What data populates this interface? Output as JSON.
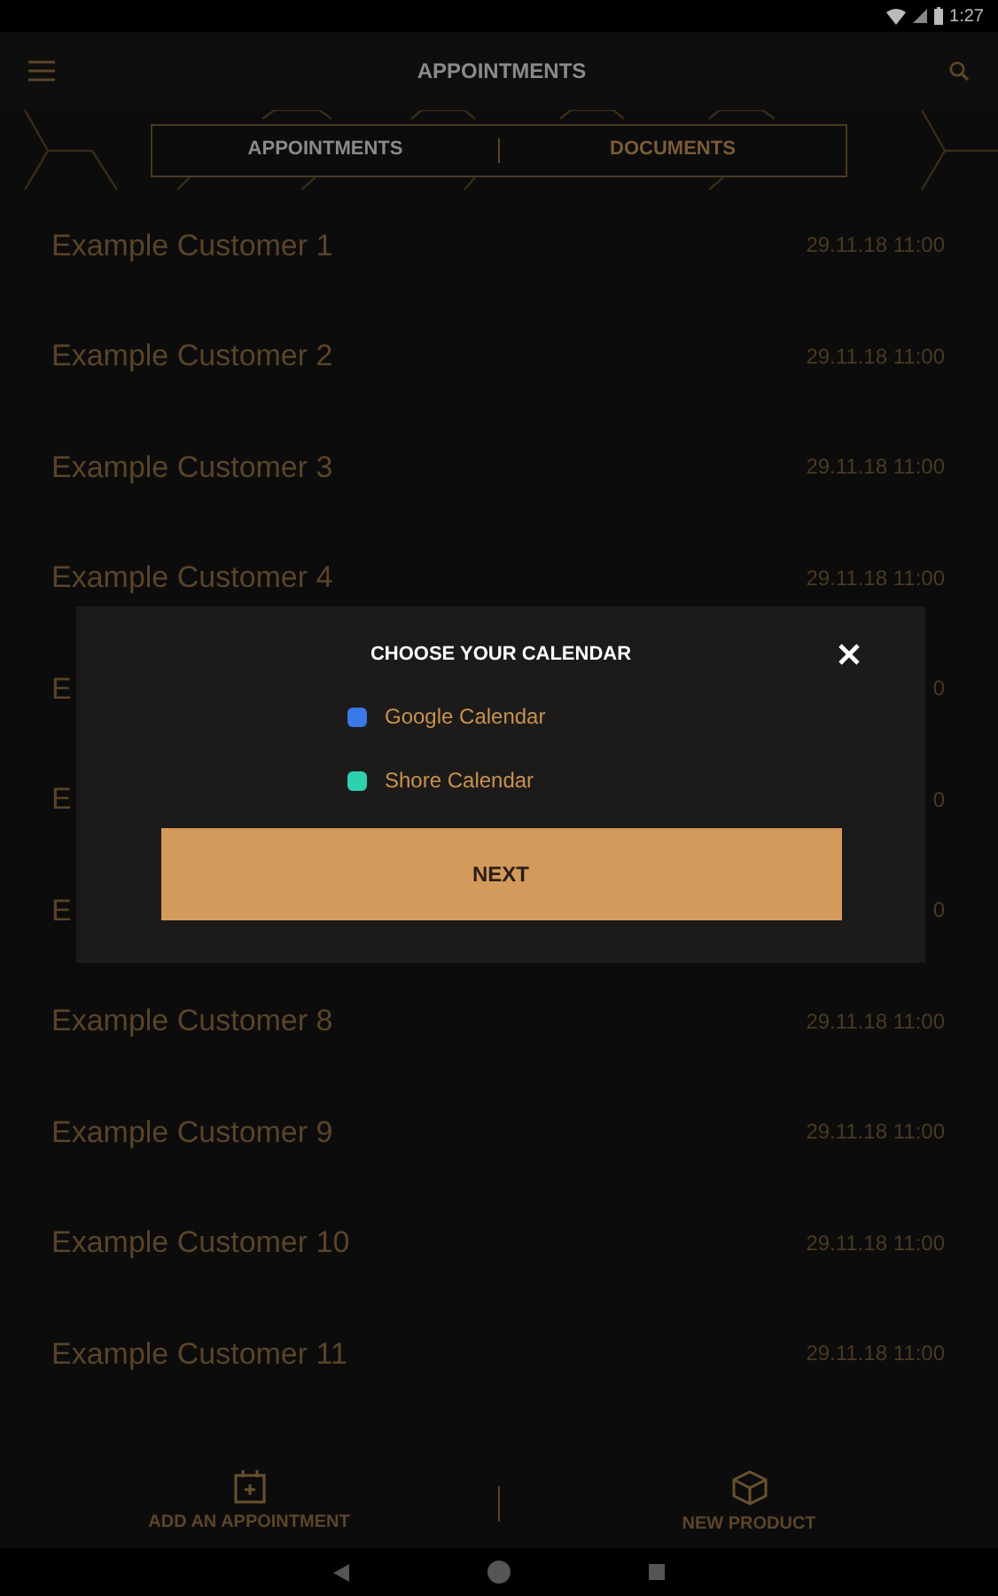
{
  "status_bar": {
    "time": "1:27"
  },
  "app_bar": {
    "title": "APPOINTMENTS"
  },
  "tabs": [
    {
      "label": "APPOINTMENTS",
      "selected": true
    },
    {
      "label": "DOCUMENTS",
      "selected": false
    }
  ],
  "appointments": [
    {
      "customer": "Example Customer 1",
      "time": "29.11.18 11:00"
    },
    {
      "customer": "Example Customer 2",
      "time": "29.11.18 11:00"
    },
    {
      "customer": "Example Customer 3",
      "time": "29.11.18 11:00"
    },
    {
      "customer": "Example Customer 4",
      "time": "29.11.18 11:00"
    },
    {
      "customer": "E",
      "time": "0"
    },
    {
      "customer": "E",
      "time": "0"
    },
    {
      "customer": "E",
      "time": "0"
    },
    {
      "customer": "Example Customer 8",
      "time": "29.11.18 11:00"
    },
    {
      "customer": "Example Customer 9",
      "time": "29.11.18 11:00"
    },
    {
      "customer": "Example Customer 10",
      "time": "29.11.18 11:00"
    },
    {
      "customer": "Example Customer 11",
      "time": "29.11.18 11:00"
    }
  ],
  "dialog": {
    "title": "CHOOSE YOUR CALENDAR",
    "options": [
      {
        "label": "Google Calendar",
        "color": "#3b78e7"
      },
      {
        "label": "Shore Calendar",
        "color": "#2fd0b0"
      }
    ],
    "button": "NEXT"
  },
  "bottom_bar": [
    {
      "label": "ADD AN APPOINTMENT",
      "kind": "calendar"
    },
    {
      "label": "NEW PRODUCT",
      "kind": "box"
    }
  ]
}
